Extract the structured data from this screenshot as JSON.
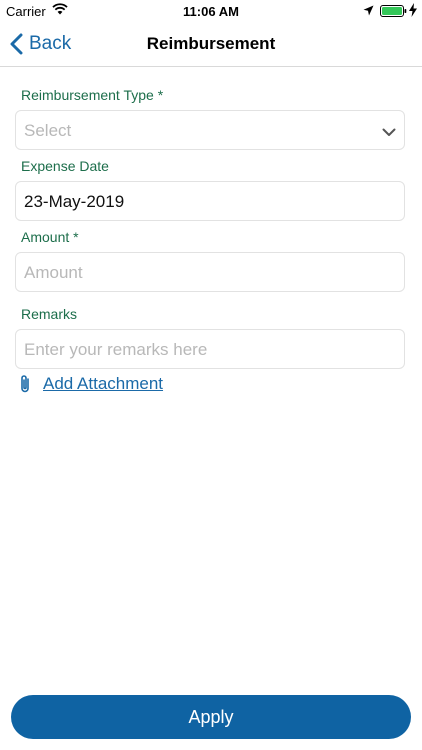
{
  "status_bar": {
    "carrier": "Carrier",
    "time": "11:06 AM"
  },
  "nav": {
    "back_label": "Back",
    "title": "Reimbursement"
  },
  "form": {
    "reimbursement_type": {
      "label": "Reimbursement Type *",
      "placeholder": "Select"
    },
    "expense_date": {
      "label": "Expense Date",
      "value": "23-May-2019"
    },
    "amount": {
      "label": "Amount *",
      "placeholder": "Amount"
    },
    "remarks": {
      "label": "Remarks",
      "placeholder": "Enter your remarks here"
    },
    "attachment_label": "Add Attachment"
  },
  "apply_label": "Apply",
  "colors": {
    "accent": "#1b6aa8",
    "label": "#1d6e4b",
    "button": "#0f63a3"
  },
  "icons": {
    "wifi": "wifi-icon",
    "location": "location-arrow-icon",
    "battery": "battery-icon",
    "charging": "charging-bolt-icon",
    "back": "chevron-left-icon",
    "dropdown": "chevron-down-icon",
    "attachment": "paperclip-icon"
  }
}
